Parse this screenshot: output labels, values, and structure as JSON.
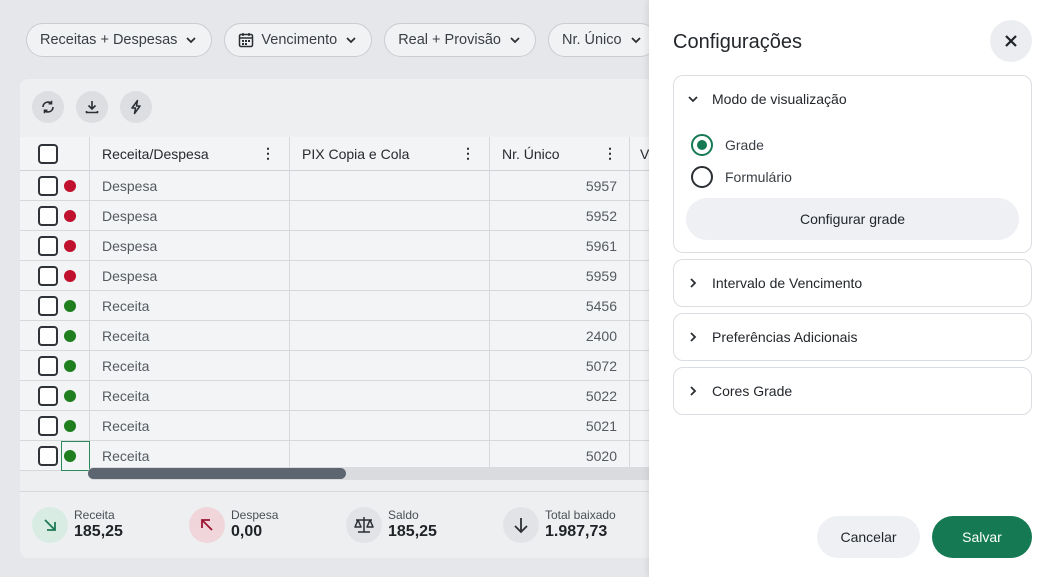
{
  "filters": [
    {
      "label": "Receitas + Despesas"
    },
    {
      "label": "Vencimento"
    },
    {
      "label": "Real + Provisão"
    },
    {
      "label": "Nr. Único"
    }
  ],
  "toolbar": {
    "icons": [
      "refresh-icon",
      "download-icon",
      "bolt-icon"
    ]
  },
  "grid": {
    "columns": [
      "Receita/Despesa",
      "PIX Copia e Cola",
      "Nr. Único",
      "V"
    ],
    "rows": [
      {
        "type": "Despesa",
        "pix": "",
        "nr": "5957",
        "status_color": "#c0112e"
      },
      {
        "type": "Despesa",
        "pix": "",
        "nr": "5952",
        "status_color": "#c0112e"
      },
      {
        "type": "Despesa",
        "pix": "",
        "nr": "5961",
        "status_color": "#c0112e"
      },
      {
        "type": "Despesa",
        "pix": "",
        "nr": "5959",
        "status_color": "#c0112e"
      },
      {
        "type": "Receita",
        "pix": "",
        "nr": "5456",
        "status_color": "#1f7f1f"
      },
      {
        "type": "Receita",
        "pix": "",
        "nr": "2400",
        "status_color": "#1f7f1f"
      },
      {
        "type": "Receita",
        "pix": "",
        "nr": "5072",
        "status_color": "#1f7f1f"
      },
      {
        "type": "Receita",
        "pix": "",
        "nr": "5022",
        "status_color": "#1f7f1f"
      },
      {
        "type": "Receita",
        "pix": "",
        "nr": "5021",
        "status_color": "#1f7f1f"
      },
      {
        "type": "Receita",
        "pix": "",
        "nr": "5020",
        "status_color": "#1f7f1f"
      }
    ]
  },
  "totals": [
    {
      "label": "Receita",
      "value": "185,25",
      "icon": "arrow-down-right-icon",
      "bg": "#d8ece4",
      "fg": "#1c7a55"
    },
    {
      "label": "Despesa",
      "value": "0,00",
      "icon": "arrow-up-left-icon",
      "bg": "#f0d6da",
      "fg": "#9c1530"
    },
    {
      "label": "Saldo",
      "value": "185,25",
      "icon": "scale-icon",
      "bg": "#e2e3e6",
      "fg": "#2b2f33"
    },
    {
      "label": "Total baixado",
      "value": "1.987,73",
      "icon": "arrow-down-icon",
      "bg": "#e2e3e6",
      "fg": "#2b2f33"
    }
  ],
  "drawer": {
    "title": "Configurações",
    "view_mode": {
      "title": "Modo de visualização",
      "options": [
        "Grade",
        "Formulário"
      ],
      "selected": "Grade",
      "config_button": "Configurar grade"
    },
    "sections": [
      "Intervalo de Vencimento",
      "Preferências Adicionais",
      "Cores Grade"
    ],
    "cancel_label": "Cancelar",
    "save_label": "Salvar"
  },
  "colors": {
    "accent": "#157a53",
    "despesa": "#c0112e",
    "receita": "#1f7f1f"
  }
}
